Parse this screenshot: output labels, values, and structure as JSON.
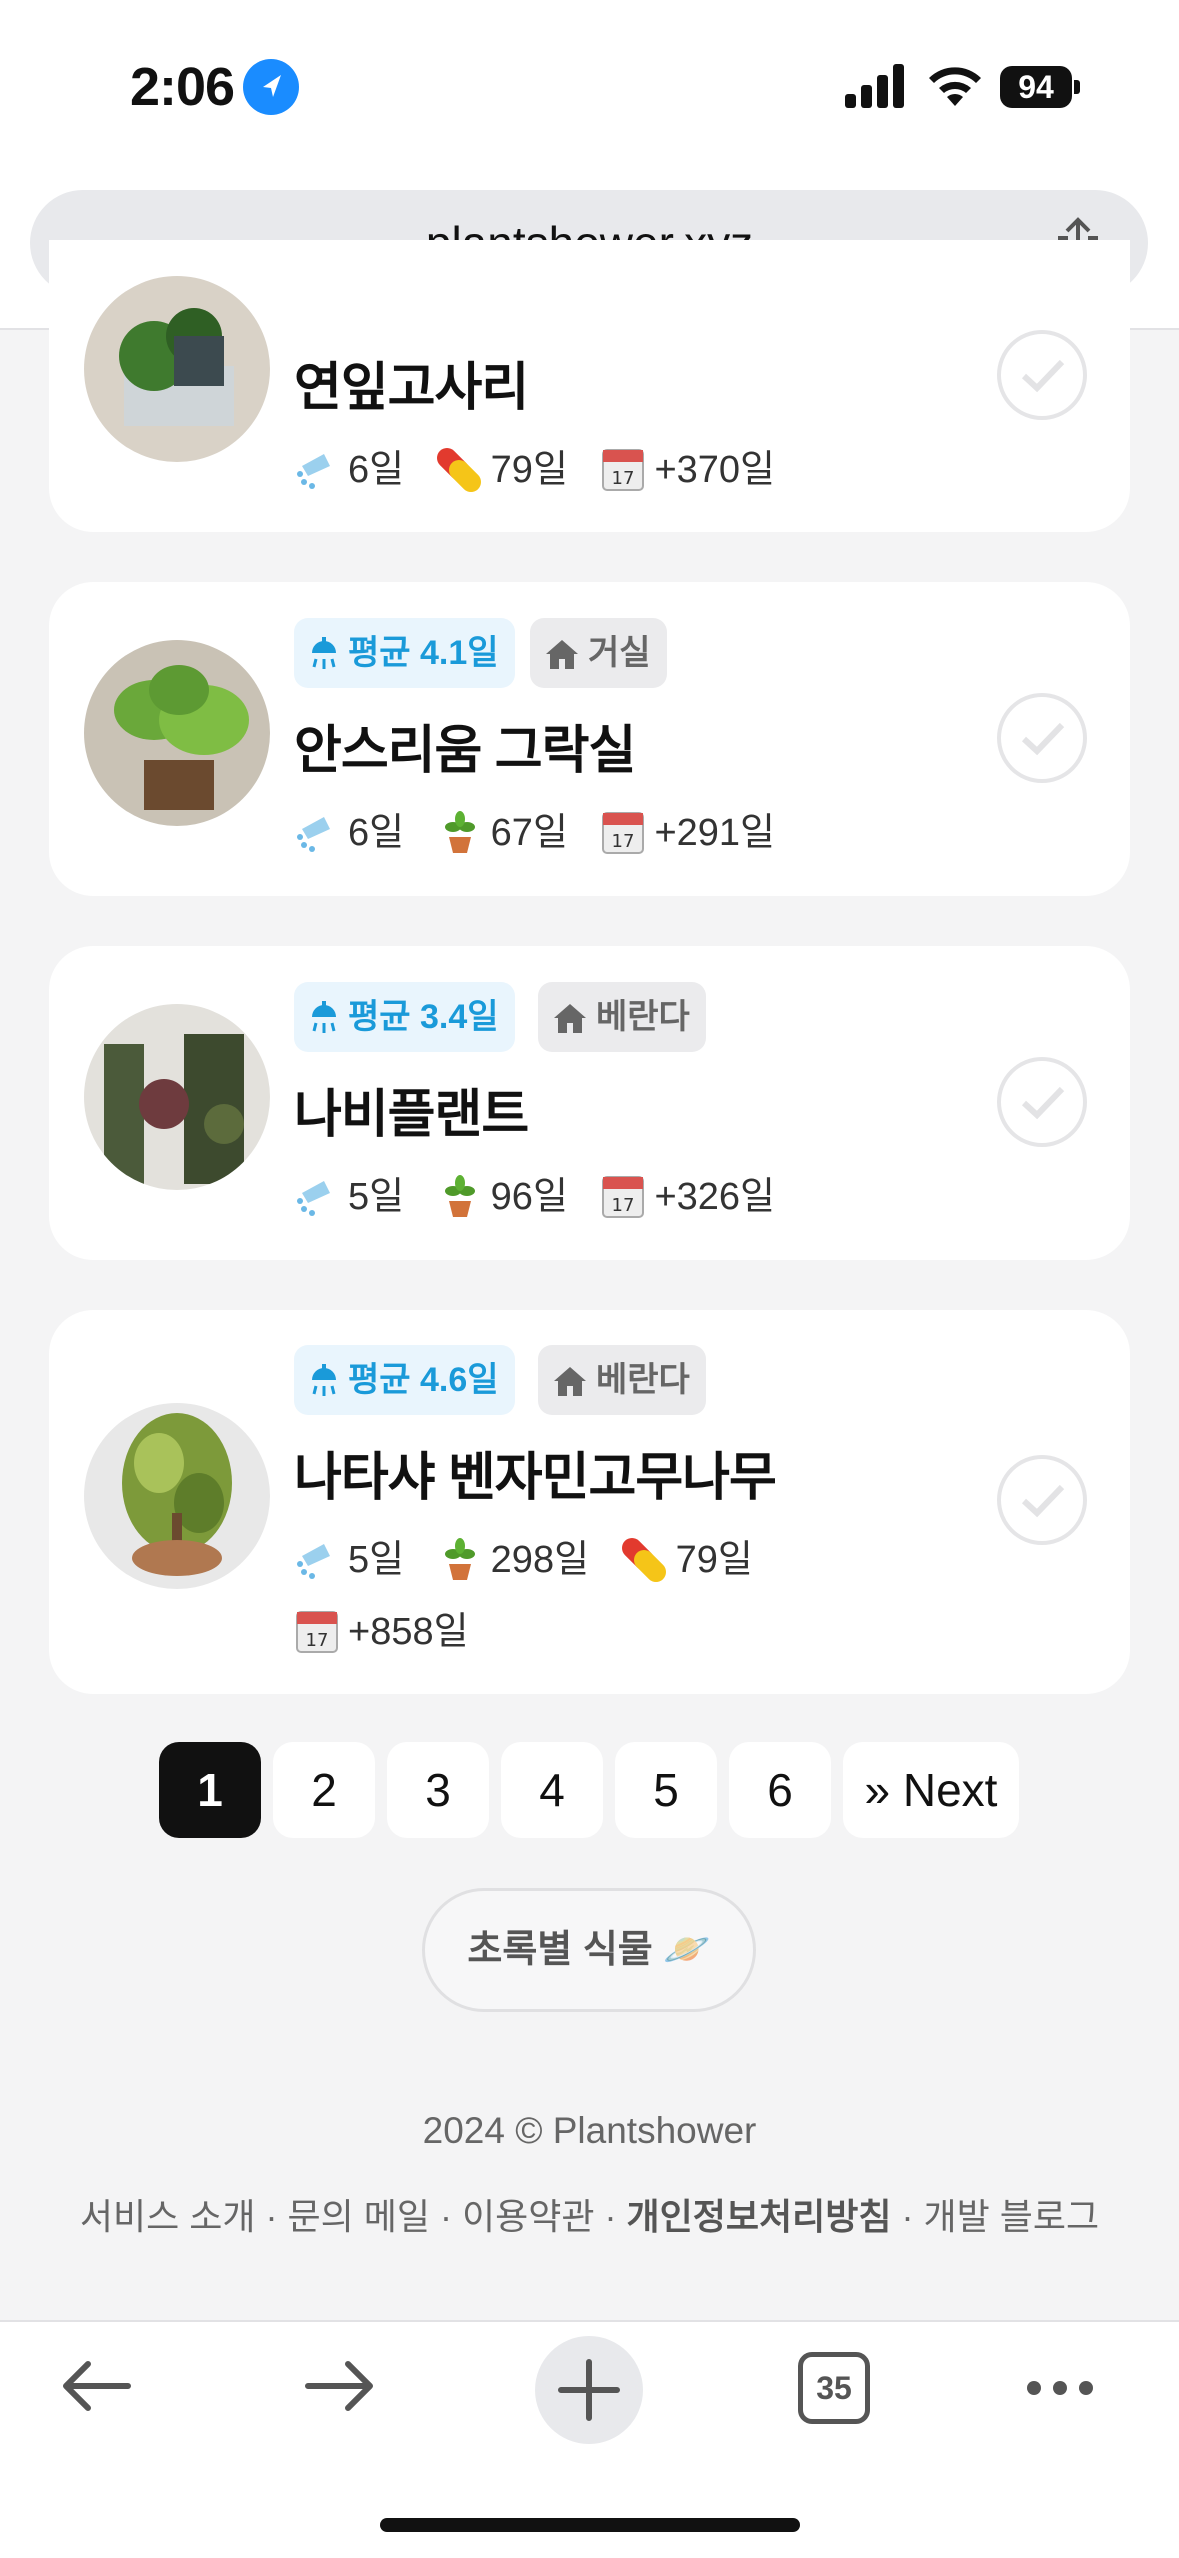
{
  "status": {
    "time": "2:06",
    "battery": "94"
  },
  "browser": {
    "url": "plantshower.xyz",
    "tabs_count": "35"
  },
  "plants": [
    {
      "name": "연잎고사리",
      "water": "6일",
      "extra1": "79일",
      "days": "+370일"
    },
    {
      "avg": "평균 4.1일",
      "location": "거실",
      "name": "안스리움 그락실",
      "water": "6일",
      "extra1": "67일",
      "days": "+291일"
    },
    {
      "avg": "평균 3.4일",
      "location": "베란다",
      "name": "나비플랜트",
      "water": "5일",
      "extra1": "96일",
      "days": "+326일"
    },
    {
      "avg": "평균 4.6일",
      "location": "베란다",
      "name": "나타샤 벤자민고무나무",
      "water": "5일",
      "extra1": "298일",
      "extra2": "79일",
      "days": "+858일"
    }
  ],
  "pagination": {
    "pages": [
      "1",
      "2",
      "3",
      "4",
      "5",
      "6"
    ],
    "next": "» Next",
    "active": "1"
  },
  "green_button": "초록별 식물 🪐",
  "footer": {
    "copyright": "2024 © Plantshower",
    "links": [
      "서비스 소개",
      "문의 메일",
      "이용약관",
      "개인정보처리방침",
      "개발 블로그"
    ]
  }
}
